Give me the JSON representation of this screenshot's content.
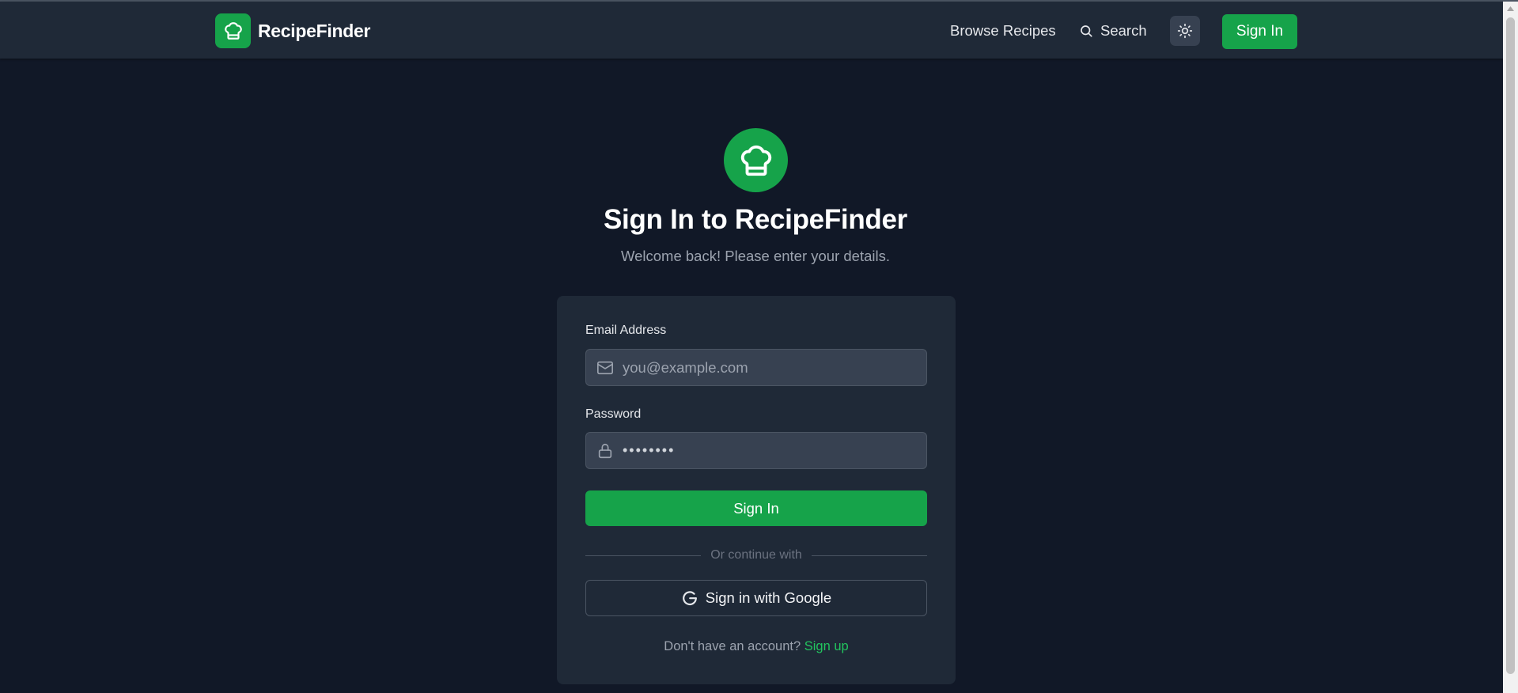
{
  "header": {
    "brand_name": "RecipeFinder",
    "brand_icon": "chef-hat-icon",
    "nav_browse": "Browse Recipes",
    "nav_search": "Search",
    "theme_icon": "sun-icon",
    "signin_label": "Sign In"
  },
  "hero": {
    "icon": "chef-hat-icon",
    "title": "Sign In to RecipeFinder",
    "subtitle": "Welcome back! Please enter your details."
  },
  "form": {
    "email_label": "Email Address",
    "email_placeholder": "you@example.com",
    "email_value": "",
    "password_label": "Password",
    "password_value": "••••••••",
    "submit_label": "Sign In",
    "divider_text": "Or continue with",
    "google_label": "Sign in with Google",
    "signup_prompt": "Don't have an account?",
    "signup_link": "Sign up"
  },
  "colors": {
    "accent": "#16a34a",
    "background": "#111827",
    "surface": "#1f2937",
    "input": "#374151",
    "link": "#22c55e"
  }
}
